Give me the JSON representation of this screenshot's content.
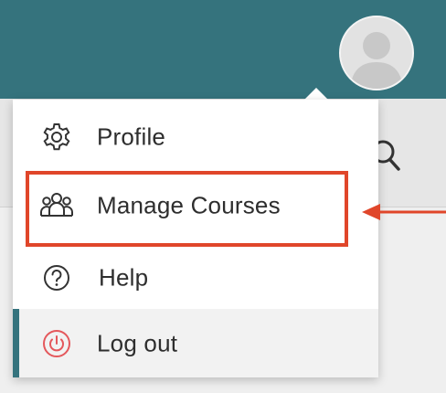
{
  "menu": {
    "items": [
      {
        "label": "Profile",
        "icon": "gear-icon"
      },
      {
        "label": "Manage Courses",
        "icon": "users-group-icon"
      },
      {
        "label": "Help",
        "icon": "question-circle-icon"
      },
      {
        "label": "Log out",
        "icon": "power-icon"
      }
    ]
  },
  "colors": {
    "topbar": "#35737d",
    "highlight": "#e0462a",
    "logout_icon": "#e4585c",
    "accent": "#35737d"
  },
  "annotations": {
    "highlighted_item": "Manage Courses"
  }
}
